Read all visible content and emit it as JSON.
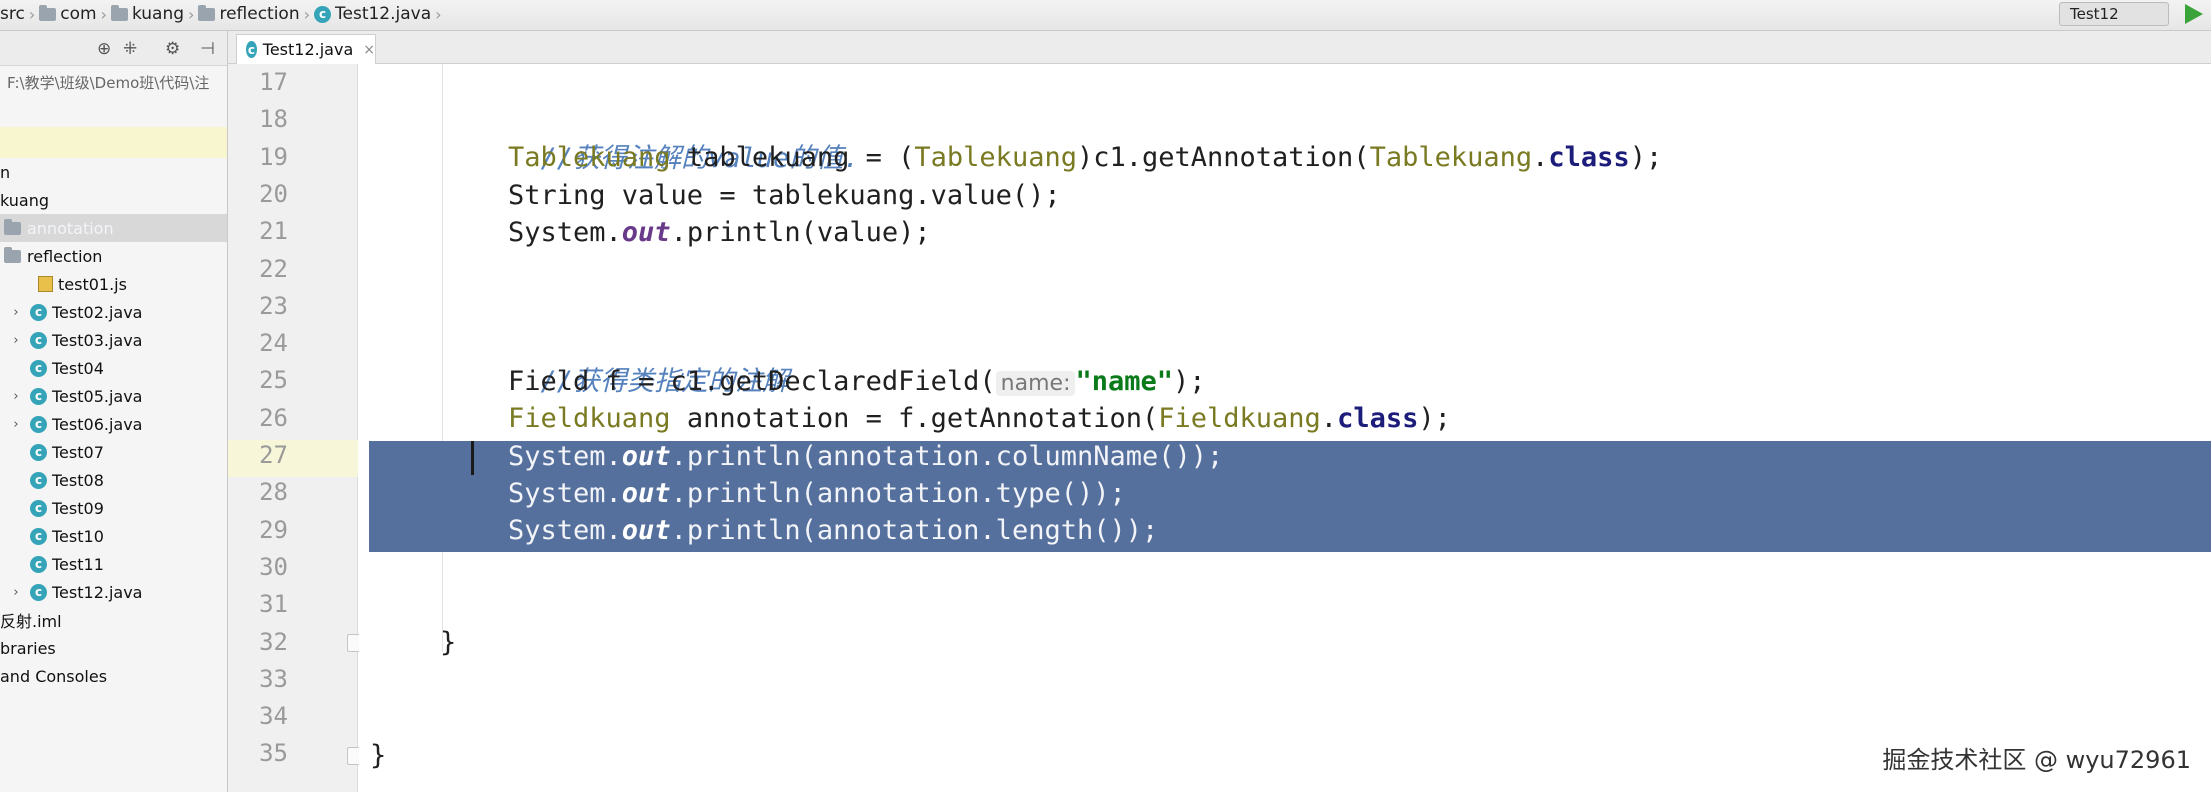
{
  "breadcrumb": {
    "items": [
      "src",
      "com",
      "kuang",
      "reflection",
      "Test12.java"
    ]
  },
  "run_config": {
    "label": "Test12"
  },
  "project": {
    "path_label": "F:\\教学\\班级\\Demo班\\代码\\注",
    "tree": [
      {
        "label": "n",
        "indent": 0,
        "icon": "none",
        "expandable": false,
        "selected": false
      },
      {
        "label": "kuang",
        "indent": 0,
        "icon": "none",
        "expandable": false,
        "selected": false
      },
      {
        "label": "annotation",
        "indent": 0,
        "icon": "folder-icon",
        "expandable": false,
        "selected": true
      },
      {
        "label": "reflection",
        "indent": 0,
        "icon": "folder-icon",
        "expandable": false,
        "selected": false
      },
      {
        "label": "test01.js",
        "indent": 1,
        "icon": "js-file-icon",
        "expandable": false,
        "selected": false
      },
      {
        "label": "Test02.java",
        "indent": 1,
        "icon": "class-icon",
        "expandable": true,
        "selected": false
      },
      {
        "label": "Test03.java",
        "indent": 1,
        "icon": "class-icon",
        "expandable": true,
        "selected": false
      },
      {
        "label": "Test04",
        "indent": 1,
        "icon": "class-icon",
        "expandable": false,
        "selected": false
      },
      {
        "label": "Test05.java",
        "indent": 1,
        "icon": "class-icon",
        "expandable": true,
        "selected": false
      },
      {
        "label": "Test06.java",
        "indent": 1,
        "icon": "class-icon",
        "expandable": true,
        "selected": false
      },
      {
        "label": "Test07",
        "indent": 1,
        "icon": "class-icon",
        "expandable": false,
        "selected": false
      },
      {
        "label": "Test08",
        "indent": 1,
        "icon": "class-icon",
        "expandable": false,
        "selected": false
      },
      {
        "label": "Test09",
        "indent": 1,
        "icon": "class-icon",
        "expandable": false,
        "selected": false
      },
      {
        "label": "Test10",
        "indent": 1,
        "icon": "class-icon",
        "expandable": false,
        "selected": false
      },
      {
        "label": "Test11",
        "indent": 1,
        "icon": "class-icon",
        "expandable": false,
        "selected": false
      },
      {
        "label": "Test12.java",
        "indent": 1,
        "icon": "class-icon",
        "expandable": true,
        "selected": false
      },
      {
        "label": "反射.iml",
        "indent": 0,
        "icon": "none",
        "expandable": false,
        "selected": false
      },
      {
        "label": "braries",
        "indent": 0,
        "icon": "none",
        "expandable": false,
        "selected": false
      },
      {
        "label": "and Consoles",
        "indent": 0,
        "icon": "none",
        "expandable": false,
        "selected": false
      }
    ]
  },
  "editor": {
    "tab_label": "Test12.java",
    "class_icon_letter": "c",
    "line_numbers": [
      "17",
      "18",
      "19",
      "20",
      "21",
      "22",
      "23",
      "24",
      "25",
      "26",
      "27",
      "28",
      "29",
      "30",
      "31",
      "32",
      "33",
      "34",
      "35"
    ],
    "code": {
      "l18": "//获得注解的value的值.",
      "l19": {
        "a": "Tablekuang",
        "b": " tablekuang = (",
        "c": "Tablekuang",
        "d": ")c1.getAnnotation(",
        "e": "Tablekuang",
        "f": ".",
        "g": "class",
        "h": ");"
      },
      "l20": "String value = tablekuang.value();",
      "l21": {
        "a": "System.",
        "b": "out",
        "c": ".println(value);"
      },
      "l24": "//获得类指定的注解",
      "l25": {
        "a": "Field f = c1.getDeclaredField(",
        "hint": "name:",
        "str": "\"name\"",
        "b": ");"
      },
      "l26": {
        "a": "Fieldkuang",
        "b": " annotation = f.getAnnotation(",
        "c": "Fieldkuang",
        "d": ".",
        "e": "class",
        "f": ");"
      },
      "l27": {
        "a": "System.",
        "b": "out",
        "c": ".println(annotation.columnName());"
      },
      "l28": {
        "a": "System.",
        "b": "out",
        "c": ".println(annotation.type());"
      },
      "l29": {
        "a": "System.",
        "b": "out",
        "c": ".println(annotation.length());"
      },
      "l32": "}",
      "l35": "}"
    }
  },
  "watermark": "掘金技术社区 @ wyu72961"
}
